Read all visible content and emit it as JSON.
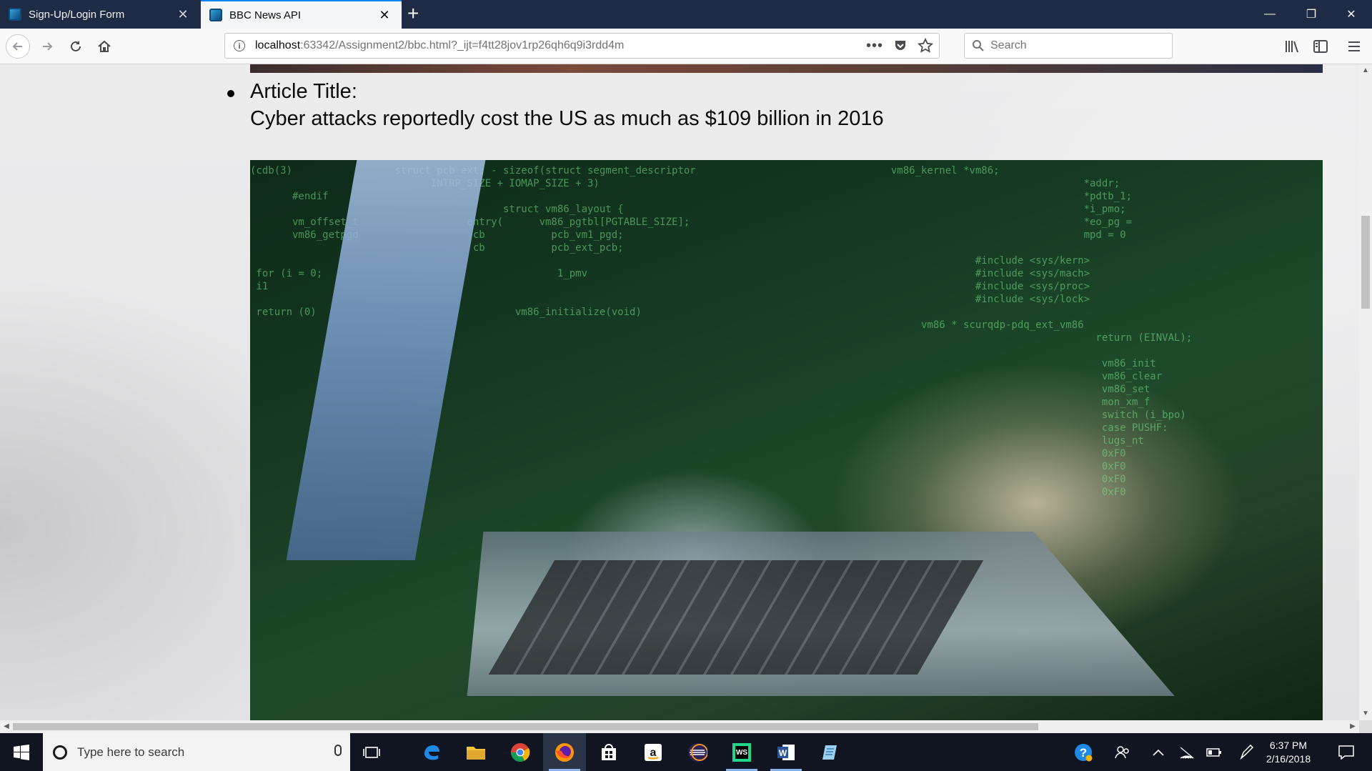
{
  "browser": {
    "tabs": [
      {
        "label": "Sign-Up/Login Form",
        "active": false
      },
      {
        "label": "BBC News API",
        "active": true
      }
    ],
    "url_host": "localhost",
    "url_path": ":63342/Assignment2/bbc.html?_ijt=f4tt28jov1rp26qh6q9i3rdd4m",
    "search_placeholder": "Search"
  },
  "article": {
    "label": "Article Title:",
    "title": "Cyber attacks reportedly cost the US as much as $109 billion in 2016"
  },
  "taskbar": {
    "search_placeholder": "Type here to search",
    "time": "6:37 PM",
    "date": "2/16/2018"
  },
  "colors": {
    "accent": "#0a84ff",
    "tabstrip": "#1f2a44",
    "taskbar": "#101521"
  }
}
